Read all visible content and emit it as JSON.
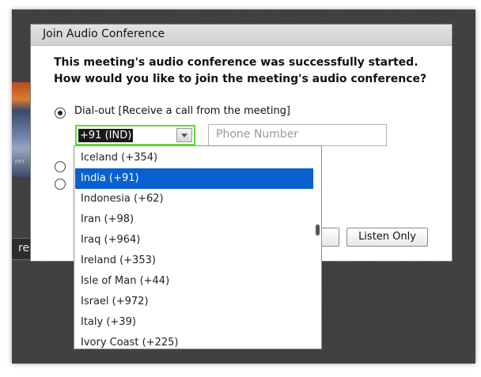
{
  "host": {
    "thumbnail_text": "PPT",
    "partial_button_text": "re"
  },
  "dialog": {
    "title": "Join Audio Conference",
    "prompt_line1": "This meeting's audio conference was successfully started.",
    "prompt_line2": "How would you like to join the meeting's audio conference?",
    "options": [
      {
        "label": "Dial-out [Receive a call from the meeting]",
        "selected": true
      },
      {
        "label": "",
        "selected": false
      },
      {
        "label": "",
        "selected": false
      }
    ],
    "country_code_value": "+91 (IND)",
    "phone_placeholder": "Phone Number",
    "listen_only_label": "Listen Only"
  },
  "dropdown": {
    "items": [
      "Iceland (+354)",
      "India (+91)",
      "Indonesia (+62)",
      "Iran (+98)",
      "Iraq (+964)",
      "Ireland (+353)",
      "Isle of Man (+44)",
      "Israel (+972)",
      "Italy (+39)",
      "Ivory Coast (+225)"
    ],
    "selected_index": 1
  },
  "colors": {
    "selection": "#0a5fd1",
    "focus_ring": "#66d63e",
    "backdrop": "#3f3f3f"
  }
}
